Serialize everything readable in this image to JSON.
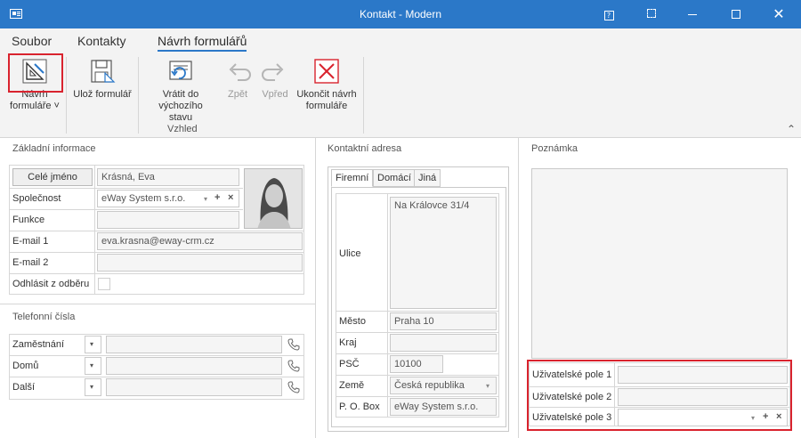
{
  "window": {
    "title": "Kontakt - Modern"
  },
  "ribbon_tabs": [
    "Soubor",
    "Kontakty",
    "Návrh formulářů"
  ],
  "ribbon": {
    "buttons": {
      "navrh_line1": "Návrh",
      "navrh_line2": "formuláře ˅",
      "uloz": "Ulož formulář",
      "vratit_line1": "Vrátit do",
      "vratit_line2": "výchozího stavu",
      "zpet": "Zpět",
      "vpred": "Vpřed",
      "ukoncit_line1": "Ukončit návrh",
      "ukoncit_line2": "formuláře"
    },
    "group_label": "Vzhled",
    "collapse_glyph": "⌃"
  },
  "basic": {
    "title": "Základní informace",
    "full_name_button": "Celé jméno",
    "full_name_value": "Krásná, Eva",
    "company_label": "Společnost",
    "company_value": "eWay System s.r.o.",
    "function_label": "Funkce",
    "function_value": "",
    "email1_label": "E-mail 1",
    "email1_value": "eva.krasna@eway-crm.cz",
    "email2_label": "E-mail 2",
    "email2_value": "",
    "unsubscribe_label": "Odhlásit z odběru"
  },
  "phones": {
    "title": "Telefonní čísla",
    "rows": [
      {
        "label": "Zaměstnání",
        "value": ""
      },
      {
        "label": "Domů",
        "value": ""
      },
      {
        "label": "Další",
        "value": ""
      }
    ]
  },
  "address": {
    "title": "Kontaktní adresa",
    "tabs": [
      "Firemní",
      "Domácí",
      "Jiná"
    ],
    "street_label": "Ulice",
    "street_value": "Na Královce 31/4",
    "city_label": "Město",
    "city_value": "Praha 10",
    "region_label": "Kraj",
    "region_value": "",
    "zip_label": "PSČ",
    "zip_value": "10100",
    "country_label": "Země",
    "country_value": "Česká republika",
    "pobox_label": "P. O. Box",
    "pobox_value": "eWay System s.r.o."
  },
  "notes": {
    "title": "Poznámka",
    "custom1_label": "Uživatelské pole 1",
    "custom1_value": "",
    "custom2_label": "Uživatelské pole 2",
    "custom2_value": "",
    "custom3_label": "Uživatelské pole 3",
    "custom3_value": ""
  },
  "glyphs": {
    "plus": "+",
    "close": "×",
    "dropdown": "▾"
  },
  "colors": {
    "titlebar": "#2b78c8",
    "highlight": "#d9232e",
    "accent": "#2b78c8"
  }
}
